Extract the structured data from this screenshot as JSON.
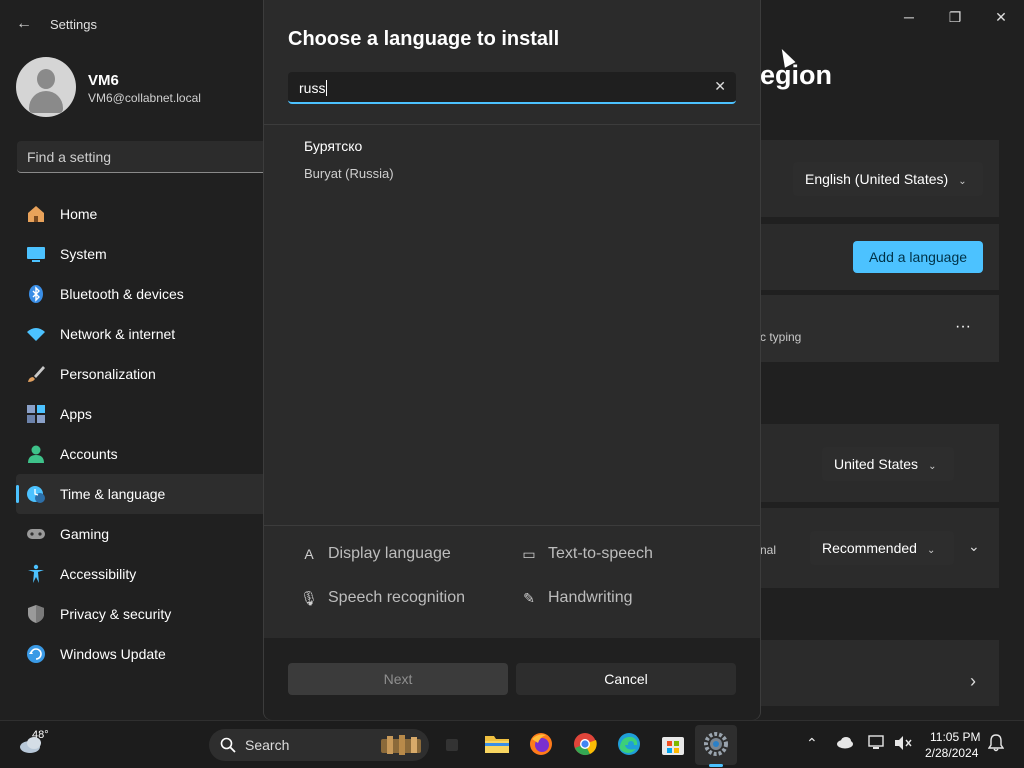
{
  "window": {
    "title": "Settings",
    "back_glyph": "←",
    "minimize_glyph": "─",
    "maximize_glyph": "❐",
    "close_glyph": "✕"
  },
  "profile": {
    "name": "VM6",
    "email": "VM6@collabnet.local"
  },
  "search": {
    "placeholder": "Find a setting"
  },
  "nav": {
    "active": "Time & language",
    "items": [
      {
        "label": "Home",
        "icon": "home-icon",
        "color": "#e8a25a"
      },
      {
        "label": "System",
        "icon": "system-icon",
        "color": "#4cc2ff"
      },
      {
        "label": "Bluetooth & devices",
        "icon": "bluetooth-icon",
        "color": "#3a8ee6"
      },
      {
        "label": "Network & internet",
        "icon": "wifi-icon",
        "color": "#4cc2ff"
      },
      {
        "label": "Personalization",
        "icon": "brush-icon",
        "color": "#e0a060"
      },
      {
        "label": "Apps",
        "icon": "apps-icon",
        "color": "#8aa0c8"
      },
      {
        "label": "Accounts",
        "icon": "accounts-icon",
        "color": "#3ec28a"
      },
      {
        "label": "Time & language",
        "icon": "time-language-icon",
        "color": "#4cc2ff"
      },
      {
        "label": "Gaming",
        "icon": "gaming-icon",
        "color": "#9a9a9a"
      },
      {
        "label": "Accessibility",
        "icon": "accessibility-icon",
        "color": "#4cc2ff"
      },
      {
        "label": "Privacy & security",
        "icon": "shield-icon",
        "color": "#9a9a9a"
      },
      {
        "label": "Windows Update",
        "icon": "update-icon",
        "color": "#3a9ae6"
      }
    ]
  },
  "background": {
    "heading_fragment": "egion",
    "windows_display_language": "English (United States)",
    "add_language_label": "Add a language",
    "typing_fragment": "c typing",
    "more_glyph": "···",
    "country_value": "United States",
    "format_fragment": "nal",
    "format_value": "Recommended",
    "chevron_glyph": "⌄",
    "arrow_glyph": "›"
  },
  "dialog": {
    "title": "Choose a language to install",
    "search_value": "russ",
    "clear_glyph": "✕",
    "results": [
      {
        "native": "Бурятско",
        "name": "Buryat (Russia)"
      }
    ],
    "features": [
      {
        "label": "Display language",
        "icon": "display-language-icon",
        "glyph": "A"
      },
      {
        "label": "Text-to-speech",
        "icon": "text-to-speech-icon",
        "glyph": "▭"
      },
      {
        "label": "Speech recognition",
        "icon": "microphone-icon",
        "glyph": "🎙"
      },
      {
        "label": "Handwriting",
        "icon": "handwriting-icon",
        "glyph": "✎"
      }
    ],
    "next_label": "Next",
    "cancel_label": "Cancel"
  },
  "taskbar": {
    "weather_temp": "48°",
    "search_label": "Search",
    "time": "11:05 PM",
    "date": "2/28/2024",
    "accent": "#4cc2ff"
  }
}
